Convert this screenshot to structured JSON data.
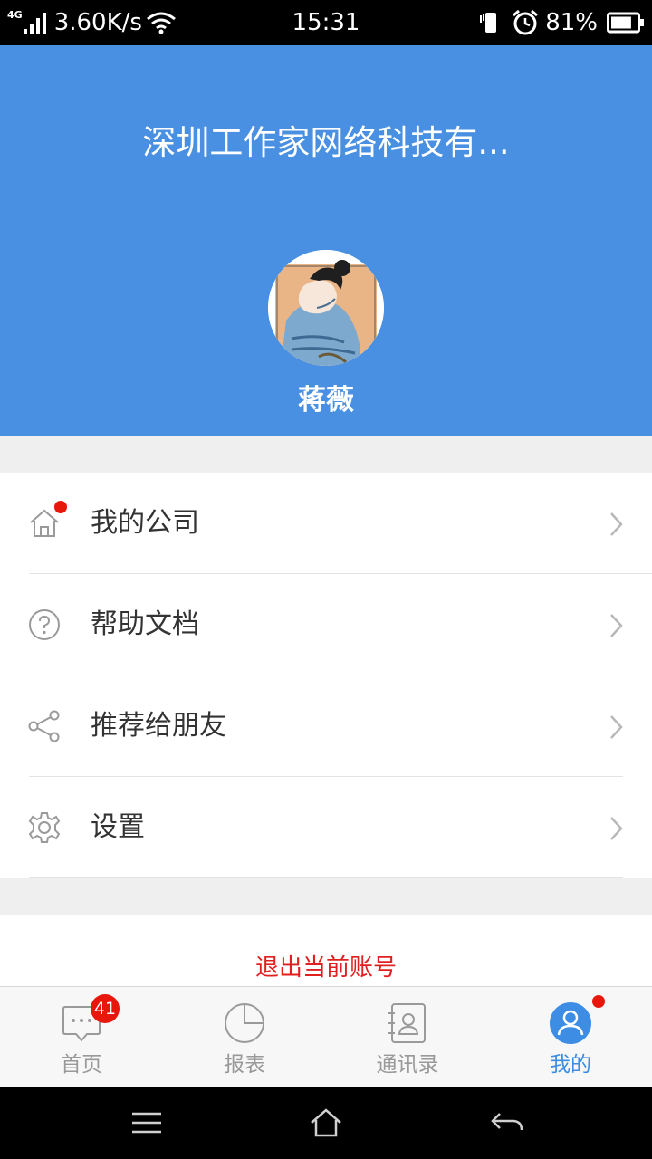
{
  "status_bar": {
    "network_type": "4G",
    "speed": "3.60K/s",
    "time": "15:31",
    "battery": "81%",
    "battery_level": 0.81,
    "icons": [
      "signal-icon",
      "wifi-icon",
      "vibrate-icon",
      "alarm-icon",
      "battery-icon"
    ]
  },
  "header": {
    "company": "深圳工作家网络科技有...",
    "user_name": "蒋薇",
    "background_color": "#4a90e2"
  },
  "menu": {
    "items": [
      {
        "label": "我的公司",
        "icon": "home-icon",
        "has_dot": true
      },
      {
        "label": "帮助文档",
        "icon": "help-icon",
        "has_dot": false
      },
      {
        "label": "推荐给朋友",
        "icon": "share-icon",
        "has_dot": false
      },
      {
        "label": "设置",
        "icon": "settings-icon",
        "has_dot": false
      }
    ]
  },
  "logout": {
    "label": "退出当前账号",
    "color": "#e02020"
  },
  "tabbar": {
    "tabs": [
      {
        "label": "首页",
        "icon": "chat-icon",
        "badge": "41",
        "active": false
      },
      {
        "label": "报表",
        "icon": "pie-chart-icon",
        "active": false
      },
      {
        "label": "通讯录",
        "icon": "contacts-icon",
        "active": false
      },
      {
        "label": "我的",
        "icon": "user-icon",
        "active": true,
        "has_dot": true
      }
    ],
    "active_color": "#3d8de4"
  },
  "navbar": {
    "icons": [
      "menu-icon",
      "home-icon",
      "back-icon"
    ]
  }
}
